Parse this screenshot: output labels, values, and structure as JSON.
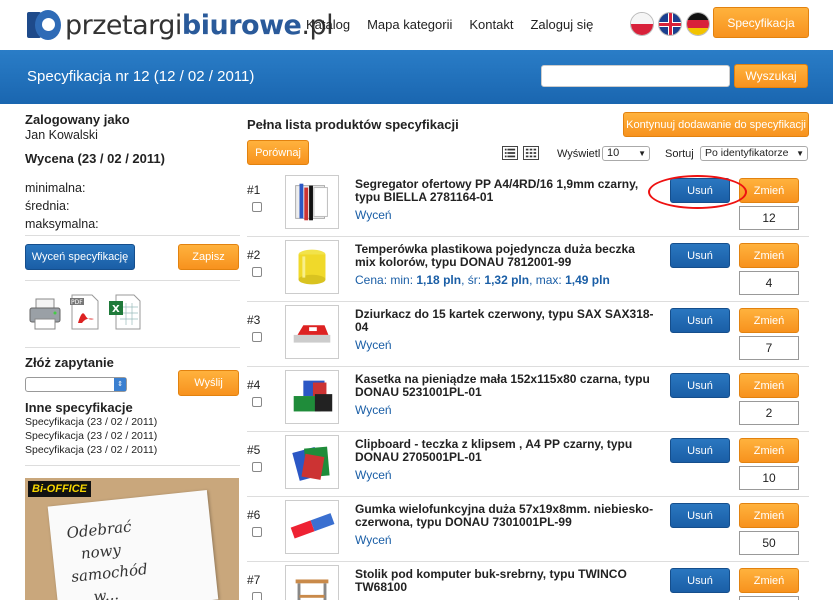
{
  "header": {
    "logo_prefix": "przetargi",
    "logo_bold": "biurowe",
    "logo_suffix": ".pl",
    "nav": [
      "Katalog",
      "Mapa kategorii",
      "Kontakt",
      "Zaloguj się"
    ],
    "spec_button": "Specyfikacja"
  },
  "band": {
    "title": "Specyfikacja nr 12 (12 / 02 / 2011)",
    "search_value": "",
    "search_button": "Wyszukaj"
  },
  "sidebar": {
    "logged_as_label": "Zalogowany jako",
    "user_name": "Jan Kowalski",
    "valuation_title": "Wycena (23 / 02 / 2011)",
    "min_label": "minimalna:",
    "avg_label": "średnia:",
    "max_label": "maksymalna:",
    "valuate_button": "Wyceń specyfikację",
    "save_button": "Zapisz",
    "inquiry_title": "Złóż zapytanie",
    "send_button": "Wyślij",
    "other_specs_title": "Inne specyfikacje",
    "other_specs": [
      "Specyfikacja (23 / 02 / 2011)",
      "Specyfikacja (23 / 02 / 2011)",
      "Specyfikacja (23 / 02 / 2011)"
    ],
    "ad": {
      "brand": "Bi-OFFICE",
      "handwriting": [
        "Odebrać",
        "nowy",
        "samochód",
        "w..."
      ]
    }
  },
  "main": {
    "title": "Pełna lista produktów specyfikacji",
    "continue_button": "Kontynuuj dodawanie do specyfikacji",
    "compare_button": "Porównaj",
    "show_label": "Wyświetl",
    "show_value": "10",
    "sort_label": "Sortuj",
    "sort_value": "Po identyfikatorze",
    "delete_label": "Usuń",
    "change_label": "Zmień",
    "products": [
      {
        "num": "#1",
        "name": "Segregator ofertowy PP A4/4RD/16 1,9mm czarny, typu BIELLA 2781164-01",
        "price": "Wyceń",
        "qty": "12",
        "thumb": "binder"
      },
      {
        "num": "#2",
        "name": "Temperówka plastikowa pojedyncza duża beczka mix kolorów, typu DONAU 7812001-99",
        "price_prefix": "Cena: min:",
        "price_min": "1,18 pln",
        "price_avg_label": ", śr:",
        "price_avg": "1,32 pln",
        "price_max_label": ", max:",
        "price_max": "1,49 pln",
        "qty": "4",
        "thumb": "sharpener"
      },
      {
        "num": "#3",
        "name": "Dziurkacz do 15 kartek czerwony, typu SAX SAX318-04",
        "price": "Wyceń",
        "qty": "7",
        "thumb": "punch"
      },
      {
        "num": "#4",
        "name": "Kasetka na pieniądze mała 152x115x80 czarna, typu DONAU 5231001PL-01",
        "price": "Wyceń",
        "qty": "2",
        "thumb": "cashbox"
      },
      {
        "num": "#5",
        "name": "Clipboard - teczka z klipsem , A4 PP czarny, typu DONAU 2705001PL-01",
        "price": "Wyceń",
        "qty": "10",
        "thumb": "clipboard"
      },
      {
        "num": "#6",
        "name": "Gumka wielofunkcyjna duża 57x19x8mm. niebiesko-czerwona, typu DONAU 7301001PL-99",
        "price": "Wyceń",
        "qty": "50",
        "thumb": "eraser"
      },
      {
        "num": "#7",
        "name": "Stolik pod komputer buk-srebrny, typu TWINCO TW68100",
        "price": "",
        "qty": "",
        "thumb": "desk"
      }
    ]
  },
  "colors": {
    "accent_blue": "#1a66b0",
    "accent_orange": "#f7921e",
    "annotation_red": "#e11111"
  }
}
